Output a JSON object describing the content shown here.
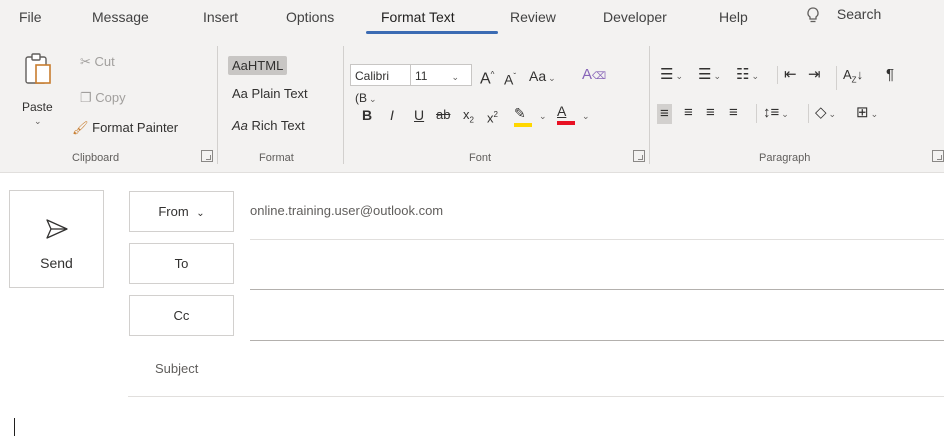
{
  "tabs": [
    {
      "label": "File"
    },
    {
      "label": "Message"
    },
    {
      "label": "Insert"
    },
    {
      "label": "Options"
    },
    {
      "label": "Format Text"
    },
    {
      "label": "Review"
    },
    {
      "label": "Developer"
    },
    {
      "label": "Help"
    }
  ],
  "search": {
    "label": "Search"
  },
  "clipboard": {
    "paste": "Paste",
    "cut": "Cut",
    "copy": "Copy",
    "format_painter": "Format Painter",
    "group_label": "Clipboard"
  },
  "format": {
    "html_prefix": "Aa",
    "html": "HTML",
    "plain_prefix": "Aa",
    "plain": "Plain Text",
    "rich_prefix": "Aa",
    "rich": "Rich Text",
    "group_label": "Format"
  },
  "font": {
    "family": "Calibri (B",
    "size": "11",
    "group_label": "Font",
    "highlight_color": "#ffd700",
    "font_color": "#e81123"
  },
  "paragraph": {
    "group_label": "Paragraph"
  },
  "compose": {
    "send": "Send",
    "from": "From",
    "to": "To",
    "cc": "Cc",
    "from_email": "online.training.user@outlook.com",
    "subject": "Subject"
  }
}
